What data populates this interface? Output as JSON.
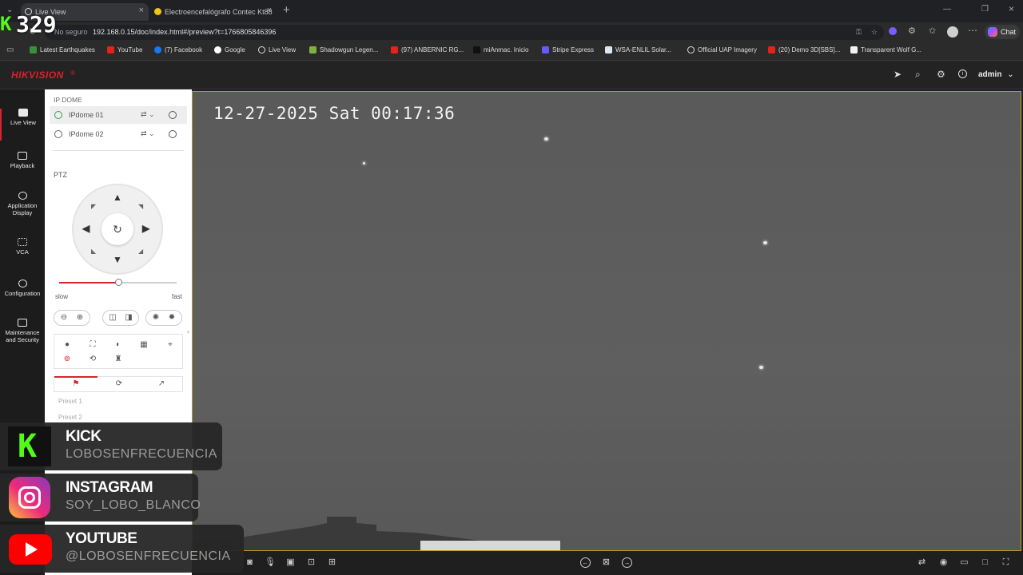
{
  "browser": {
    "tabs": [
      {
        "title": "Live View",
        "active": true
      },
      {
        "title": "Electroencefalógrafo Contec Kt88",
        "active": false
      }
    ],
    "url_prefix": "No seguro",
    "url": "192.168.0.15/doc/index.html#/preview?t=1766805846396",
    "chat_label": "Chat",
    "bookmarks": [
      "Latest Earthquakes",
      "YouTube",
      "(7) Facebook",
      "Google",
      "Live View",
      "Shadowgun Legen...",
      "(97) ANBERNIC RG...",
      "miAnmac. Inicio",
      "Stripe Express",
      "WSA-ENLIL Solar...",
      "Official UAP Imagery",
      "(20) Demo 3D[SBS]...",
      "Transparent Wolf G..."
    ]
  },
  "app": {
    "brand": "HIKVISION",
    "user": "admin",
    "nav": [
      {
        "label": "Live View",
        "icon": "monitor-icon"
      },
      {
        "label": "Playback",
        "icon": "playback-icon"
      },
      {
        "label": "Application Display",
        "icon": "application-icon"
      },
      {
        "label": "VCA",
        "icon": "vca-icon"
      },
      {
        "label": "Configuration",
        "icon": "gear-icon"
      },
      {
        "label": "Maintenance and Security",
        "icon": "maintenance-icon"
      }
    ],
    "device_group": "IP DOME",
    "devices": [
      "IPdome 01",
      "IPdome 02"
    ],
    "ptz_label": "PTZ",
    "speed_slow": "slow",
    "speed_fast": "fast",
    "speed_fraction": 0.5,
    "presets": [
      "Preset 1",
      "Preset 2"
    ]
  },
  "video": {
    "osd_timestamp": "12-27-2025 Sat 00:17:36"
  },
  "overlay": {
    "counter": "329",
    "socials": [
      {
        "name": "KICK",
        "handle": "LOBOSENFRECUENCIA"
      },
      {
        "name": "INSTAGRAM",
        "handle": "SOY_LOBO_BLANCO"
      },
      {
        "name": "YOUTUBE",
        "handle": "@LOBOSENFRECUENCIA"
      }
    ]
  },
  "colors": {
    "brand_red": "#d9232d",
    "kick_green": "#53fc18",
    "accent_border": "#b89a2a"
  }
}
